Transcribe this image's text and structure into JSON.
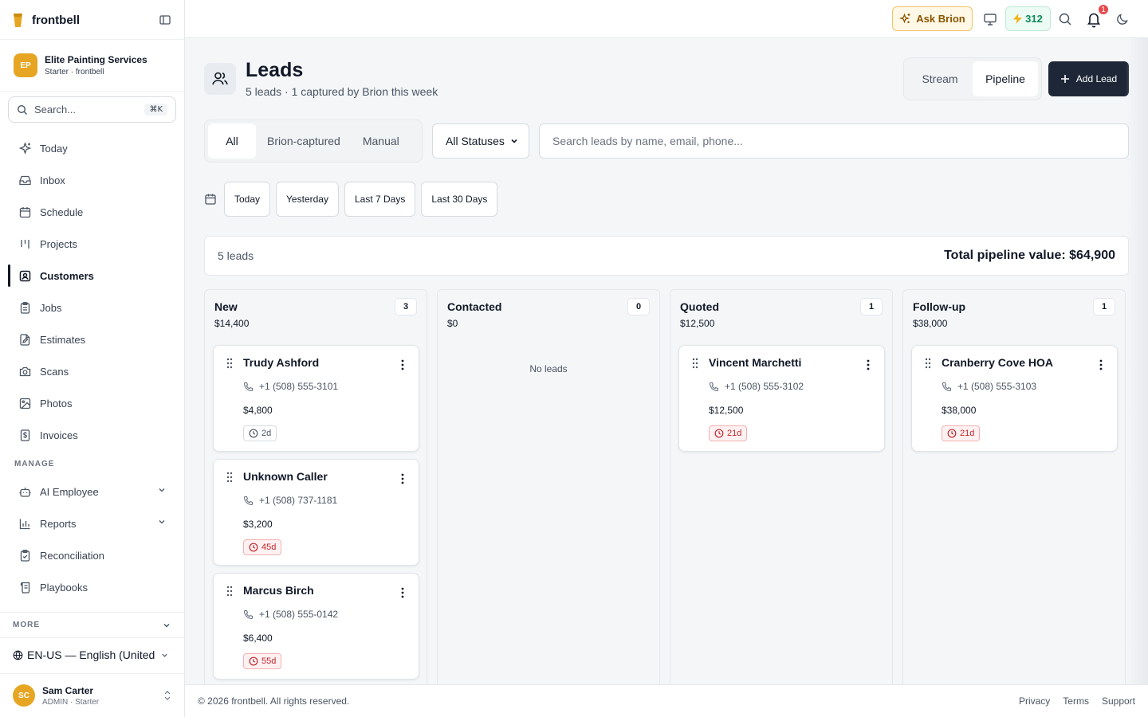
{
  "app": {
    "brand": "frontbell",
    "brand_color": "#e6a623"
  },
  "org": {
    "initials": "EP",
    "name": "Elite Painting Services",
    "plan": "Starter · frontbell"
  },
  "sidebar": {
    "search_placeholder": "Search...",
    "search_shortcut": "⌘K",
    "items": [
      {
        "label": "Today",
        "icon": "sparkle-icon"
      },
      {
        "label": "Inbox",
        "icon": "inbox-icon"
      },
      {
        "label": "Schedule",
        "icon": "calendar-icon"
      },
      {
        "label": "Projects",
        "icon": "kanban-icon"
      },
      {
        "label": "Customers",
        "icon": "contact-icon",
        "active": true
      },
      {
        "label": "Jobs",
        "icon": "clipboard-icon"
      },
      {
        "label": "Estimates",
        "icon": "file-edit-icon"
      },
      {
        "label": "Scans",
        "icon": "camera-icon"
      },
      {
        "label": "Photos",
        "icon": "image-icon"
      },
      {
        "label": "Invoices",
        "icon": "dollar-file-icon"
      }
    ],
    "manage_label": "MANAGE",
    "manage_items": [
      {
        "label": "AI Employee",
        "icon": "bot-icon"
      },
      {
        "label": "Reports",
        "icon": "bar-chart-icon"
      },
      {
        "label": "Reconciliation",
        "icon": "clipboard-check-icon"
      },
      {
        "label": "Playbooks",
        "icon": "scroll-icon"
      }
    ],
    "more_label": "MORE",
    "language": "EN-US — English (United",
    "user": {
      "initials": "SC",
      "name": "Sam Carter",
      "role": "ADMIN · Starter"
    }
  },
  "topbar": {
    "ask_label": "Ask Brion",
    "credits": "312",
    "notifications": "1"
  },
  "page": {
    "title": "Leads",
    "subtitle": "5 leads · 1 captured by Brion this week",
    "views": [
      "Stream",
      "Pipeline"
    ],
    "active_view": "Pipeline",
    "add_label": "Add Lead",
    "source_filters": [
      "All",
      "Brion-captured",
      "Manual"
    ],
    "status_select": "All Statuses",
    "search_placeholder": "Search leads by name, email, phone...",
    "date_filters": [
      "Today",
      "Yesterday",
      "Last 7 Days",
      "Last 30 Days"
    ],
    "lead_count": "5 leads",
    "pipeline_total": "Total pipeline value: $64,900"
  },
  "columns": [
    {
      "title": "New",
      "count": "3",
      "value": "$14,400",
      "cards": [
        {
          "name": "Trudy Ashford",
          "phone": "+1 (508) 555-3101",
          "amount": "$4,800",
          "age": "2d",
          "overdue": false
        },
        {
          "name": "Unknown Caller",
          "phone": "+1 (508) 737-1181",
          "amount": "$3,200",
          "age": "45d",
          "overdue": true
        },
        {
          "name": "Marcus Birch",
          "phone": "+1 (508) 555-0142",
          "amount": "$6,400",
          "age": "55d",
          "overdue": true
        }
      ]
    },
    {
      "title": "Contacted",
      "count": "0",
      "value": "$0",
      "empty": "No leads",
      "cards": []
    },
    {
      "title": "Quoted",
      "count": "1",
      "value": "$12,500",
      "cards": [
        {
          "name": "Vincent Marchetti",
          "phone": "+1 (508) 555-3102",
          "amount": "$12,500",
          "age": "21d",
          "overdue": true
        }
      ]
    },
    {
      "title": "Follow-up",
      "count": "1",
      "value": "$38,000",
      "cards": [
        {
          "name": "Cranberry Cove HOA",
          "phone": "+1 (508) 555-3103",
          "amount": "$38,000",
          "age": "21d",
          "overdue": true
        }
      ]
    }
  ],
  "footer": {
    "copyright": "© 2026 frontbell. All rights reserved.",
    "links": [
      "Privacy",
      "Terms",
      "Support"
    ]
  }
}
